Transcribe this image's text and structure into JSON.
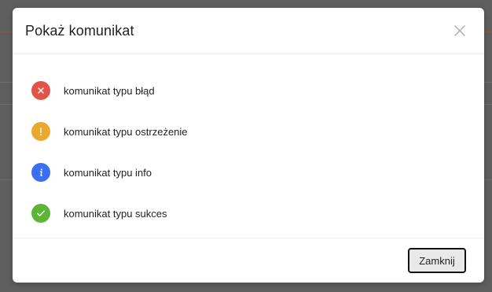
{
  "dialog": {
    "title": "Pokaż komunikat",
    "close_icon": "close-icon",
    "messages": [
      {
        "label": "komunikat typu błąd",
        "type": "error",
        "icon": "error-x-icon",
        "color": "#e2544a"
      },
      {
        "label": "komunikat typu ostrzeżenie",
        "type": "warning",
        "icon": "warning-exclamation-icon",
        "color": "#eaa92b"
      },
      {
        "label": "komunikat typu info",
        "type": "info",
        "icon": "info-icon",
        "color": "#3a6ff0"
      },
      {
        "label": "komunikat typu sukces",
        "type": "success",
        "icon": "success-check-icon",
        "color": "#5cb536"
      }
    ],
    "footer": {
      "close_button_label": "Zamknij"
    }
  },
  "colors": {
    "overlay": "#5f5f5f",
    "dialog_background": "#ffffff",
    "divider": "#ececec",
    "button_background": "#e9e9e9",
    "button_border": "#111111"
  }
}
